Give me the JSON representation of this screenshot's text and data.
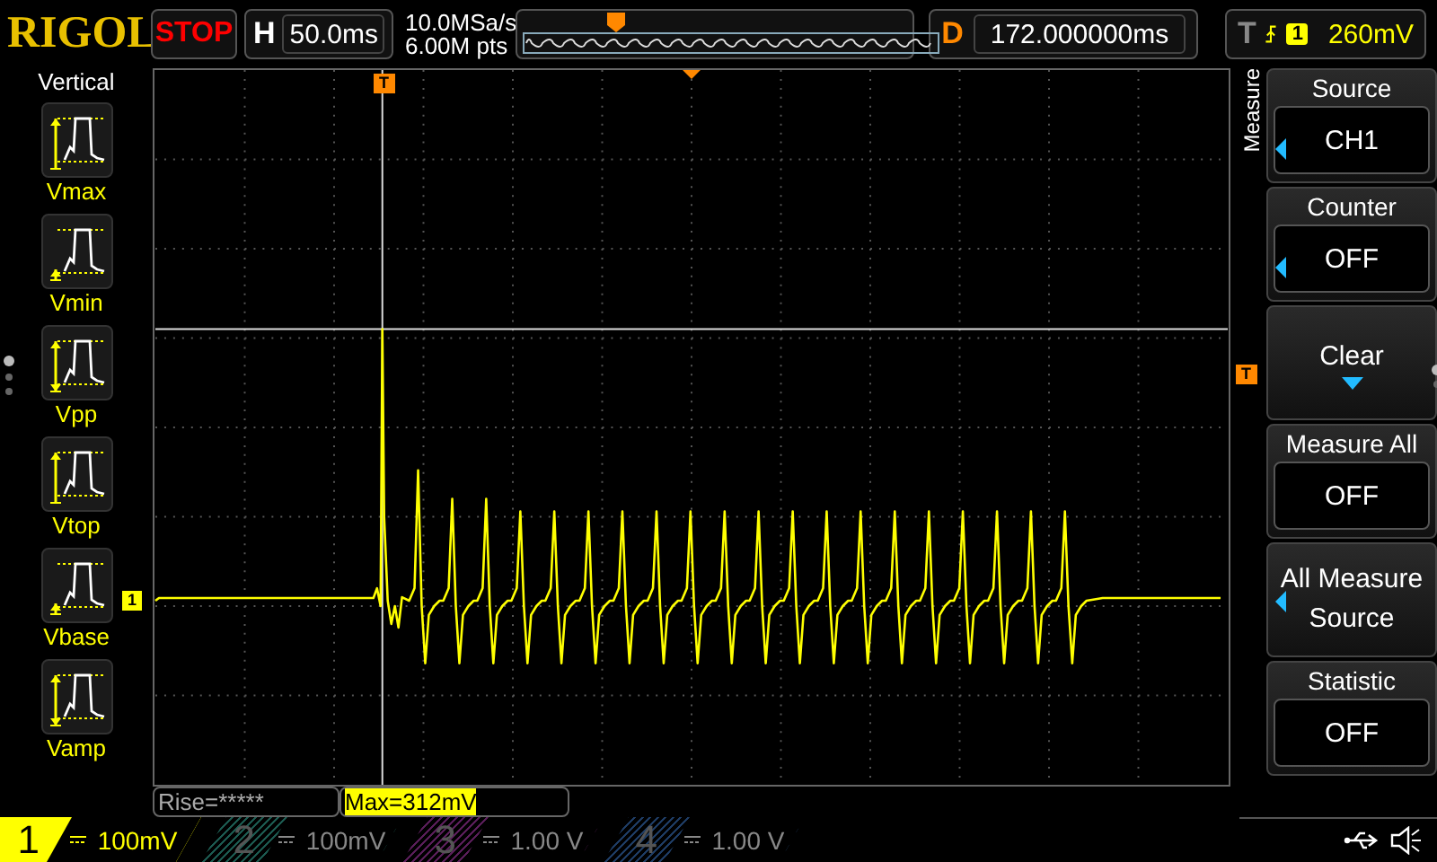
{
  "header": {
    "logo": "RIGOL",
    "run_state": "STOP",
    "timebase": {
      "label": "H",
      "value": "50.0ms"
    },
    "sample_rate": "10.0MSa/s",
    "memory_depth": "6.00M pts",
    "delay": {
      "label": "D",
      "value": "172.000000ms"
    },
    "trigger": {
      "label": "T",
      "channel": "1",
      "level": "260mV"
    }
  },
  "left_panel": {
    "title": "Vertical",
    "items": [
      {
        "label": "Vmax",
        "kind": "max"
      },
      {
        "label": "Vmin",
        "kind": "min"
      },
      {
        "label": "Vpp",
        "kind": "pp"
      },
      {
        "label": "Vtop",
        "kind": "top"
      },
      {
        "label": "Vbase",
        "kind": "base"
      },
      {
        "label": "Vamp",
        "kind": "amp"
      }
    ],
    "pages": [
      {
        "selected": true
      },
      {
        "selected": false
      },
      {
        "selected": false
      }
    ]
  },
  "plot": {
    "channel_marker": "1",
    "trigger_position_marker": "T",
    "trigger_level_marker": "T"
  },
  "measurements": [
    {
      "text": "Rise=*****",
      "selected": false
    },
    {
      "text": "Max=312mV",
      "selected": true
    }
  ],
  "right_menu": {
    "title": "Measure",
    "items": [
      {
        "kind": "value",
        "title": "Source",
        "value": "CH1",
        "adjustable": true
      },
      {
        "kind": "value",
        "title": "Counter",
        "value": "OFF",
        "adjustable": true
      },
      {
        "kind": "action",
        "title": "Clear",
        "adjustable": false
      },
      {
        "kind": "value",
        "title": "Measure All",
        "value": "OFF",
        "adjustable": false
      },
      {
        "kind": "label",
        "title": "All Measure Source",
        "adjustable": true
      },
      {
        "kind": "value",
        "title": "Statistic",
        "value": "OFF",
        "adjustable": false
      }
    ],
    "pages": [
      {
        "selected": true
      },
      {
        "selected": false
      }
    ]
  },
  "channels": [
    {
      "number": "1",
      "scale": "100mV",
      "active": true,
      "color": "#ffff00"
    },
    {
      "number": "2",
      "scale": "100mV",
      "active": false,
      "color": "#1c5a50"
    },
    {
      "number": "3",
      "scale": "1.00 V",
      "active": false,
      "color": "#5a1e5a"
    },
    {
      "number": "4",
      "scale": "1.00 V",
      "active": false,
      "color": "#1e3c64"
    }
  ]
}
